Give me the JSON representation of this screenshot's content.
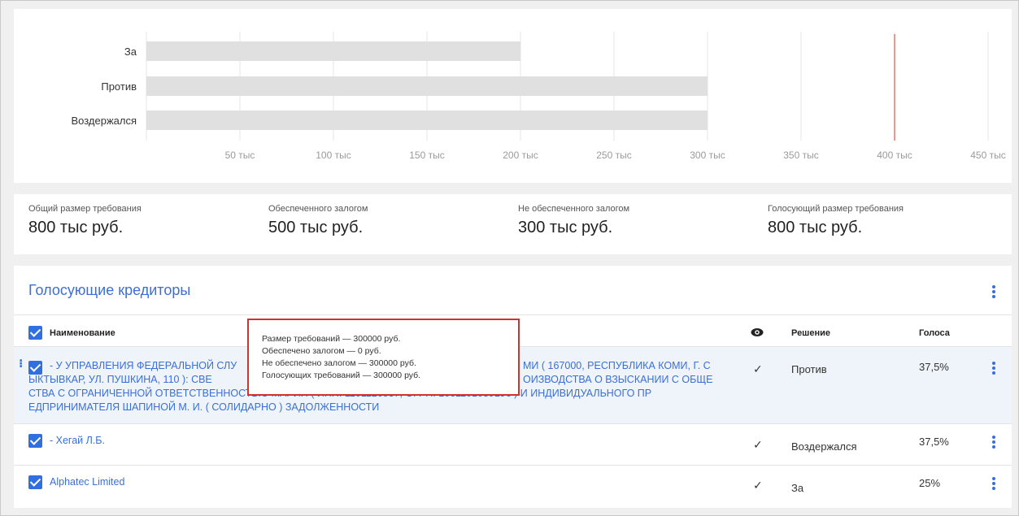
{
  "chart_data": {
    "type": "bar",
    "orientation": "horizontal",
    "categories": [
      "За",
      "Против",
      "Воздержался"
    ],
    "values": [
      200000,
      300000,
      300000
    ],
    "x_ticks": [
      50000,
      100000,
      150000,
      200000,
      250000,
      300000,
      350000,
      400000,
      450000
    ],
    "x_tick_labels": [
      "50 тыс",
      "100 тыс",
      "150 тыс",
      "200 тыс",
      "250 тыс",
      "300 тыс",
      "350 тыс",
      "400 тыс",
      "450 тыс"
    ],
    "xlim": [
      0,
      450000
    ],
    "threshold": 400000,
    "grid": true,
    "bar_color": "#e0e0e0",
    "threshold_color": "#e2533f"
  },
  "summary": [
    {
      "label": "Общий размер требования",
      "value": "800 тыс руб."
    },
    {
      "label": "Обеспеченного залогом",
      "value": "500 тыс руб."
    },
    {
      "label": "Не обеспеченного залогом",
      "value": "300 тыс руб."
    },
    {
      "label": "Голосующий размер требования",
      "value": "800 тыс руб."
    }
  ],
  "creditors": {
    "title": "Голосующие кредиторы",
    "columns": {
      "name": "Наименование",
      "decision": "Решение",
      "votes": "Голоса"
    },
    "rows": [
      {
        "name_lines": [
          "- У УПРАВЛЕНИЯ ФЕДЕРАЛЬНОЙ СЛУ",
          "ЫКТЫВКАР, УЛ. ПУШКИНА, 110 ): СВЕ",
          "СТВА С ОГРАНИЧЕННОЙ ОТВЕТСТВЕННОСТЬЮ МАРИЯ ( ИНН: 1101126837, ОГРН: 1061101039196 ) И ИНДИВИДУАЛЬНОГО ПР",
          "ЕДПРИНИМАТЕЛЯ ШАПИНОЙ М. И. ( СОЛИДАРНО ) ЗАДОЛЖЕННОСТИ"
        ],
        "name_tail_lines": [
          "МИ ( 167000, РЕСПУБЛИКА КОМИ, Г. С",
          "ОИЗВОДСТВА О ВЗЫСКАНИИ С ОБЩЕ"
        ],
        "check": "✓",
        "decision": "Против",
        "votes": "37,5%"
      },
      {
        "name": "- Хегай Л.Б.",
        "check": "✓",
        "decision": "Воздержался",
        "votes": "37,5%"
      },
      {
        "name": "Alphatec Limited",
        "check": "✓",
        "decision": "За",
        "votes": "25%"
      }
    ]
  },
  "tooltip": {
    "lines": [
      "Размер требований — 300000 руб.",
      "Обеспечено залогом — 0 руб.",
      "Не обеспечено залогом — 300000 руб.",
      "Голосующих требований — 300000 руб."
    ]
  },
  "icons": {
    "eye": "eye-icon",
    "kebab": "more-vert-icon",
    "drag": "drag-handle-icon",
    "checkbox": "checkbox-checked-icon"
  },
  "colors": {
    "accent": "#3a6fd8",
    "checkbox": "#2f6fe0",
    "row_highlight": "#eef4fa",
    "tooltip_border": "#d0332d"
  }
}
